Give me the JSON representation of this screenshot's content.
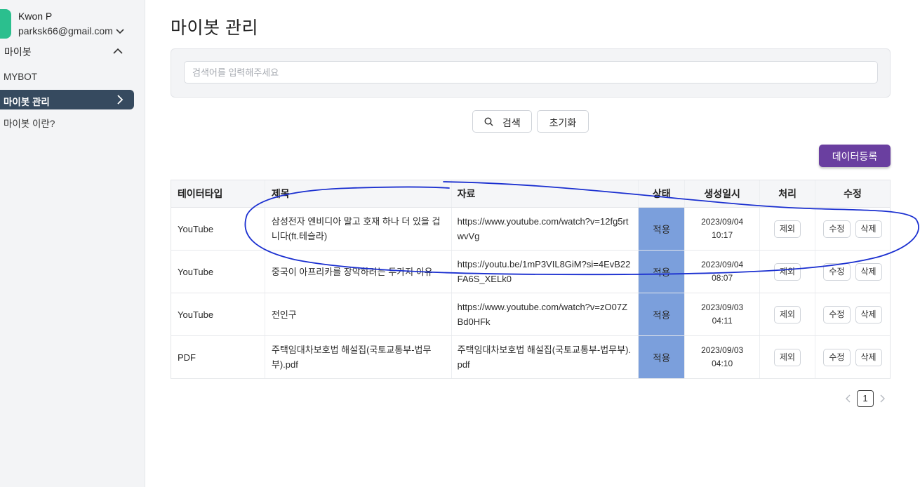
{
  "user": {
    "name": "Kwon P",
    "email": "parksk66@gmail.com"
  },
  "sidebar": {
    "group_label": "마이봇",
    "items": [
      {
        "label": "MYBOT"
      },
      {
        "label": "마이봇 관리"
      },
      {
        "label": "마이봇 이란?"
      }
    ]
  },
  "page": {
    "title": "마이봇 관리"
  },
  "search": {
    "placeholder": "검색어를 입력해주세요",
    "search_label": "검색",
    "reset_label": "초기화"
  },
  "register_label": "데이터등록",
  "table": {
    "headers": [
      "테이터타입",
      "제목",
      "자료",
      "상태",
      "생성일시",
      "처리",
      "수정"
    ],
    "rows": [
      {
        "type": "YouTube",
        "title": "삼성전자 엔비디아 말고 호재 하나 더 있을 겁니다(ft.테슬라)",
        "source": "https://www.youtube.com/watch?v=12fg5rtwvVg",
        "status": "적용",
        "date": "2023/09/04",
        "time": "10:17",
        "exclude": "제외",
        "edit": "수정",
        "delete": "삭제"
      },
      {
        "type": "YouTube",
        "title": "중국이 아프리카를 장악하려는 두가지 이유",
        "source": "https://youtu.be/1mP3VIL8GiM?si=4EvB22FA6S_XELk0",
        "status": "적용",
        "date": "2023/09/04",
        "time": "08:07",
        "exclude": "제외",
        "edit": "수정",
        "delete": "삭제"
      },
      {
        "type": "YouTube",
        "title": "전인구",
        "source": "https://www.youtube.com/watch?v=zO07ZBd0HFk",
        "status": "적용",
        "date": "2023/09/03",
        "time": "04:11",
        "exclude": "제외",
        "edit": "수정",
        "delete": "삭제"
      },
      {
        "type": "PDF",
        "title": "주택임대차보호법 해설집(국토교통부-법무부).pdf",
        "source": "주택임대차보호법 해설집(국토교통부-법무부).pdf",
        "status": "적용",
        "date": "2023/09/03",
        "time": "04:10",
        "exclude": "제외",
        "edit": "수정",
        "delete": "삭제"
      }
    ]
  },
  "pagination": {
    "current": "1"
  },
  "colors": {
    "sidebar_active": "#364a5f",
    "register_button": "#6a3fa0",
    "status_cell": "#7b9fdc",
    "annotation": "#1a2fd0"
  },
  "icons": [
    "chevron-down-icon",
    "chevron-up-icon",
    "chevron-right-icon",
    "search-icon",
    "chevron-left-icon"
  ]
}
